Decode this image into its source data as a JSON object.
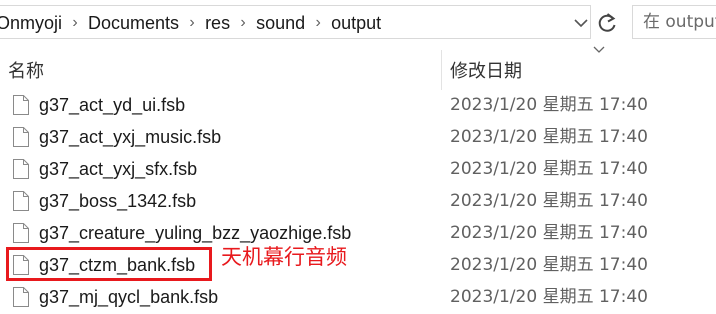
{
  "breadcrumb": {
    "items": [
      "Onmyoji",
      "Documents",
      "res",
      "sound",
      "output"
    ],
    "separator": "›"
  },
  "search": {
    "placeholder": "在 output 中搜索"
  },
  "columns": {
    "name": "名称",
    "date_modified": "修改日期"
  },
  "files": [
    {
      "name": "g37_act_yd_ui.fsb",
      "date": "2023/1/20 星期五 17:40",
      "icon": "file-icon"
    },
    {
      "name": "g37_act_yxj_music.fsb",
      "date": "2023/1/20 星期五 17:40",
      "icon": "file-icon"
    },
    {
      "name": "g37_act_yxj_sfx.fsb",
      "date": "2023/1/20 星期五 17:40",
      "icon": "file-icon"
    },
    {
      "name": "g37_boss_1342.fsb",
      "date": "2023/1/20 星期五 17:40",
      "icon": "file-icon"
    },
    {
      "name": "g37_creature_yuling_bzz_yaozhige.fsb",
      "date": "2023/1/20 星期五 17:40",
      "icon": "file-icon"
    },
    {
      "name": "g37_ctzm_bank.fsb",
      "date": "2023/1/20 星期五 17:40",
      "icon": "file-icon"
    },
    {
      "name": "g37_mj_qycl_bank.fsb",
      "date": "2023/1/20 星期五 17:40",
      "icon": "file-icon"
    }
  ],
  "annotation": {
    "text": "天机幕行音频",
    "highlighted_file": "g37_ctzm_bank.fsb",
    "color": "#e8191d"
  },
  "icons": {
    "dropdown": "chevron-down-icon",
    "refresh": "refresh-icon",
    "sort": "sort-arrow-icon"
  }
}
